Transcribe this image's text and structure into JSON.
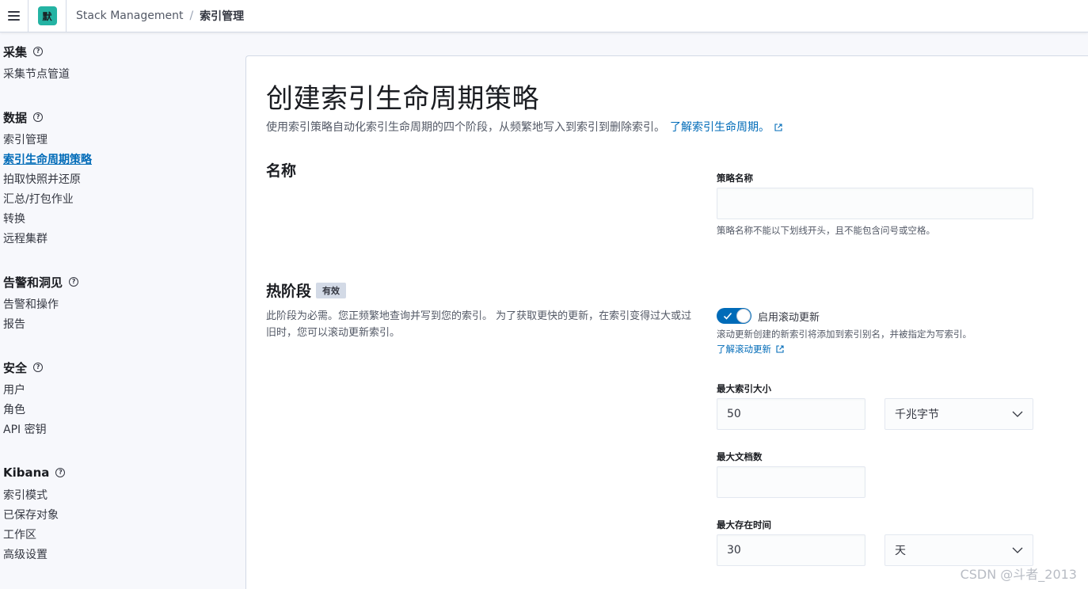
{
  "header": {
    "space_initial": "默",
    "breadcrumb_root": "Stack Management",
    "breadcrumb_sep": "/",
    "breadcrumb_current": "索引管理"
  },
  "sidebar": {
    "groups": [
      {
        "title": "采集",
        "items": [
          "采集节点管道"
        ]
      },
      {
        "title": "数据",
        "items": [
          "索引管理",
          "索引生命周期策略",
          "拍取快照并还原",
          "汇总/打包作业",
          "转换",
          "远程集群"
        ]
      },
      {
        "title": "告警和洞见",
        "items": [
          "告警和操作",
          "报告"
        ]
      },
      {
        "title": "安全",
        "items": [
          "用户",
          "角色",
          "API 密钥"
        ]
      },
      {
        "title": "Kibana",
        "items": [
          "索引模式",
          "已保存对象",
          "工作区",
          "高级设置"
        ]
      }
    ],
    "active_item": "索引生命周期策略"
  },
  "main": {
    "title": "创建索引生命周期策略",
    "description": "使用索引策略自动化索引生命周期的四个阶段，从频繁地写入到索引到删除索引。",
    "learn_link": "了解索引生命周期。",
    "name_section": {
      "title": "名称",
      "field_label": "策略名称",
      "field_value": "",
      "help": "策略名称不能以下划线开头，且不能包含问号或空格。"
    },
    "hot_phase": {
      "title": "热阶段",
      "badge": "有效",
      "description": "此阶段为必需。您正频繁地查询并写到您的索引。 为了获取更快的更新，在索引变得过大或过旧时，您可以滚动更新索引。",
      "rollover_label": "启用滚动更新",
      "rollover_enabled": true,
      "rollover_help": "滚动更新创建的新索引将添加到索引别名，并被指定为写索引。",
      "rollover_link": "了解滚动更新",
      "max_size_label": "最大索引大小",
      "max_size_value": "50",
      "max_size_unit": "千兆字节",
      "max_docs_label": "最大文档数",
      "max_docs_value": "",
      "max_age_label": "最大存在时间",
      "max_age_value": "30",
      "max_age_unit": "天"
    }
  },
  "watermark": "CSDN @斗者_2013",
  "colors": {
    "accent": "#006bb8",
    "switch_on": "#006bb8",
    "space_avatar": "#24b3a3"
  }
}
